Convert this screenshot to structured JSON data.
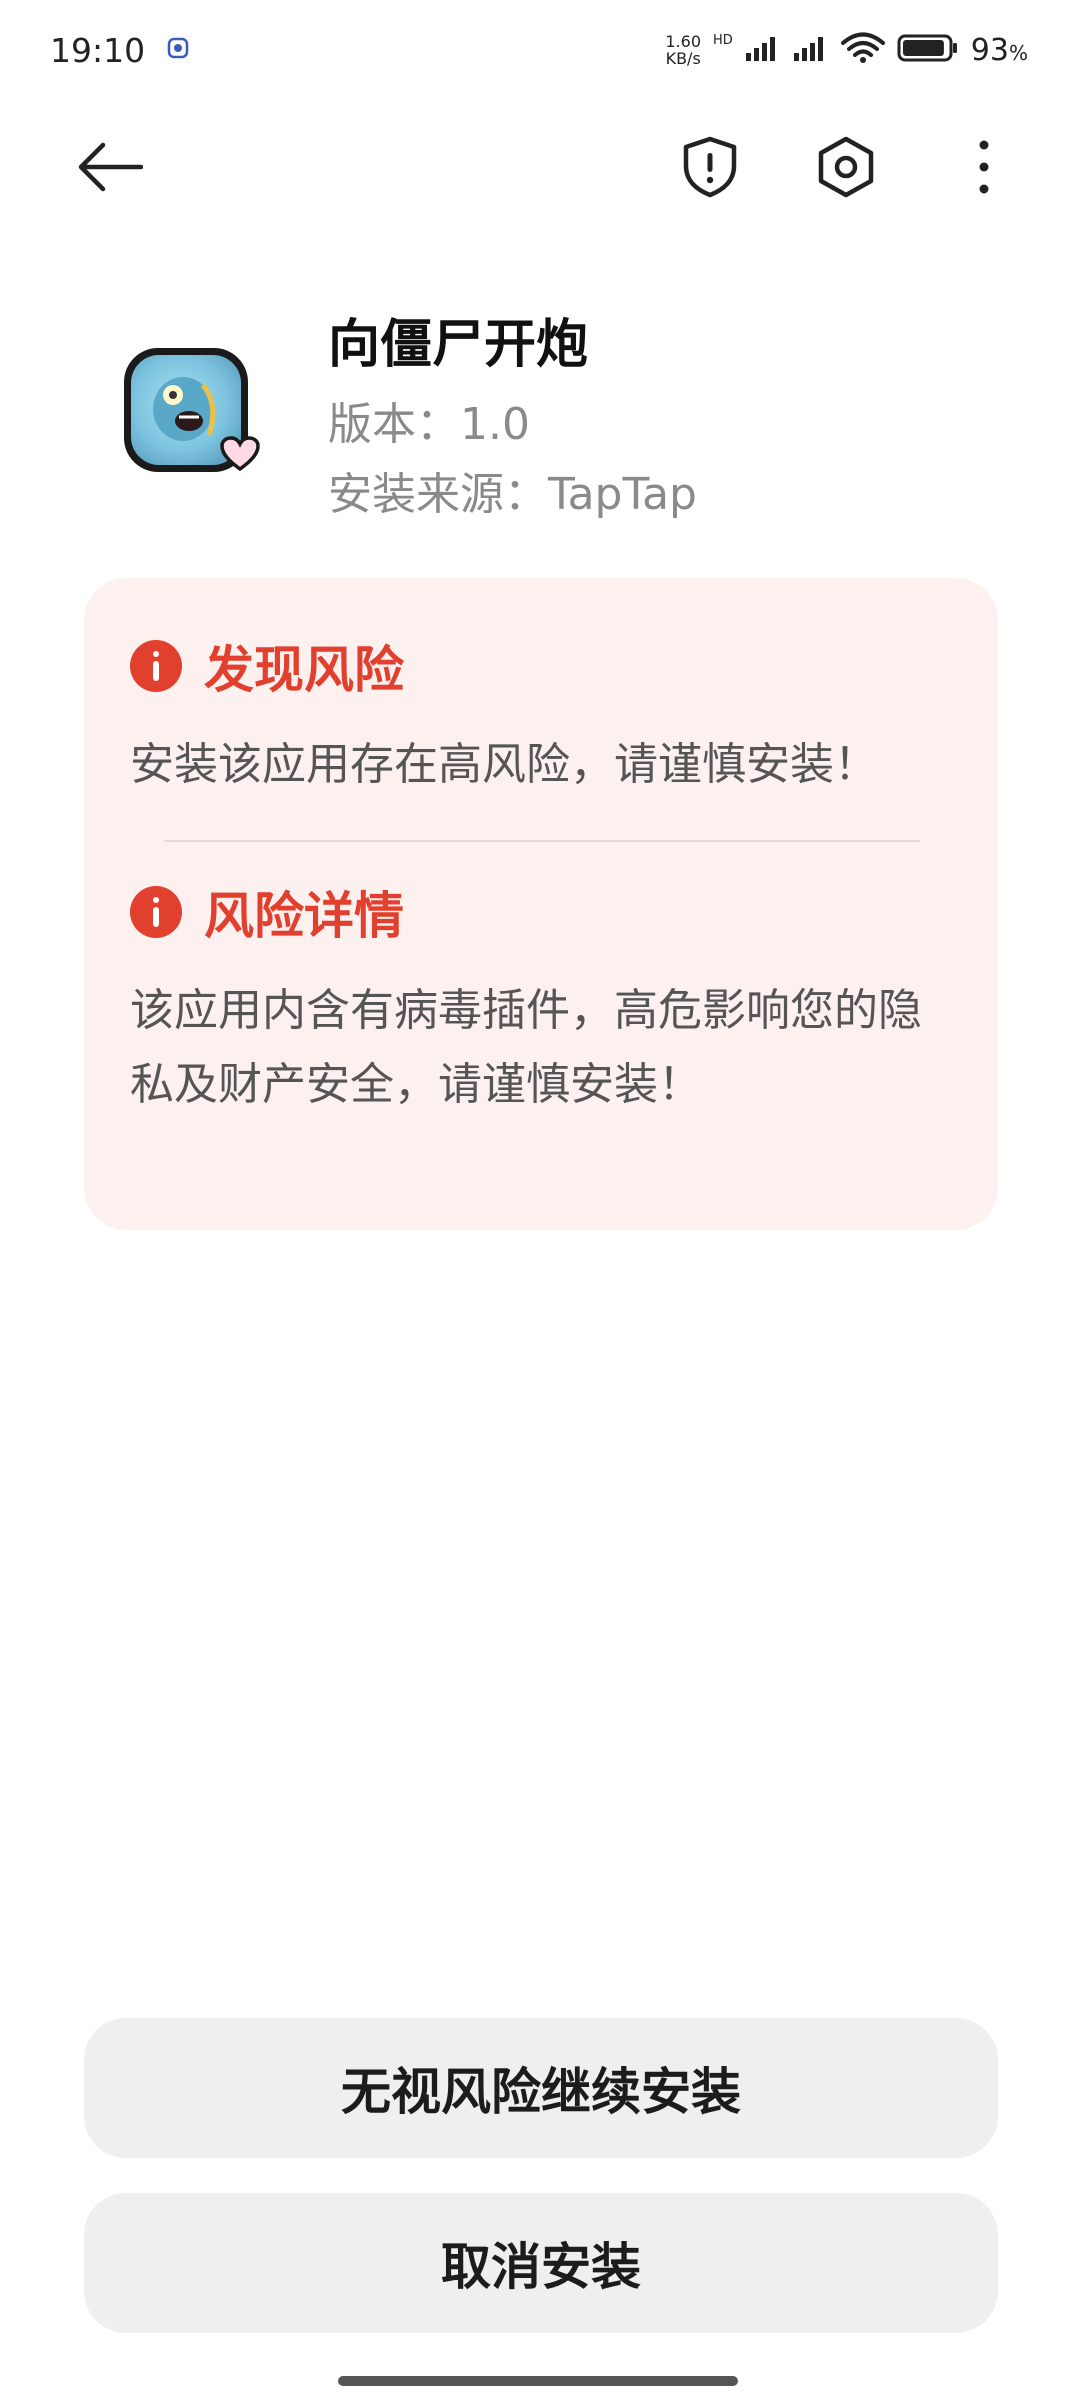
{
  "status_bar": {
    "time": "19:10",
    "net_speed_value": "1.60",
    "net_speed_unit": "KB/s",
    "hd_label": "HD",
    "battery_percent": "93",
    "battery_percent_sign": "%",
    "battery_level": 0.93
  },
  "app": {
    "name": "向僵尸开炮",
    "version": "版本：1.0",
    "source": "安装来源：TapTap"
  },
  "risk": {
    "sections": [
      {
        "title": "发现风险",
        "body": "安装该应用存在高风险，请谨慎安装！"
      },
      {
        "title": "风险详情",
        "body": "该应用内含有病毒插件，高危影响您的隐私及财产安全，请谨慎安装！"
      }
    ]
  },
  "buttons": {
    "continue_install": "无视风险继续安装",
    "cancel_install": "取消安装"
  },
  "colors": {
    "risk_red": "#e2402f",
    "risk_card_bg": "#fdf1f0",
    "button_bg": "#efefef"
  },
  "icons": {
    "back": "arrow-left-icon",
    "shield": "shield-alert-icon",
    "settings": "hexagon-gear-icon",
    "more": "more-vertical-icon",
    "info": "info-circle-icon"
  }
}
